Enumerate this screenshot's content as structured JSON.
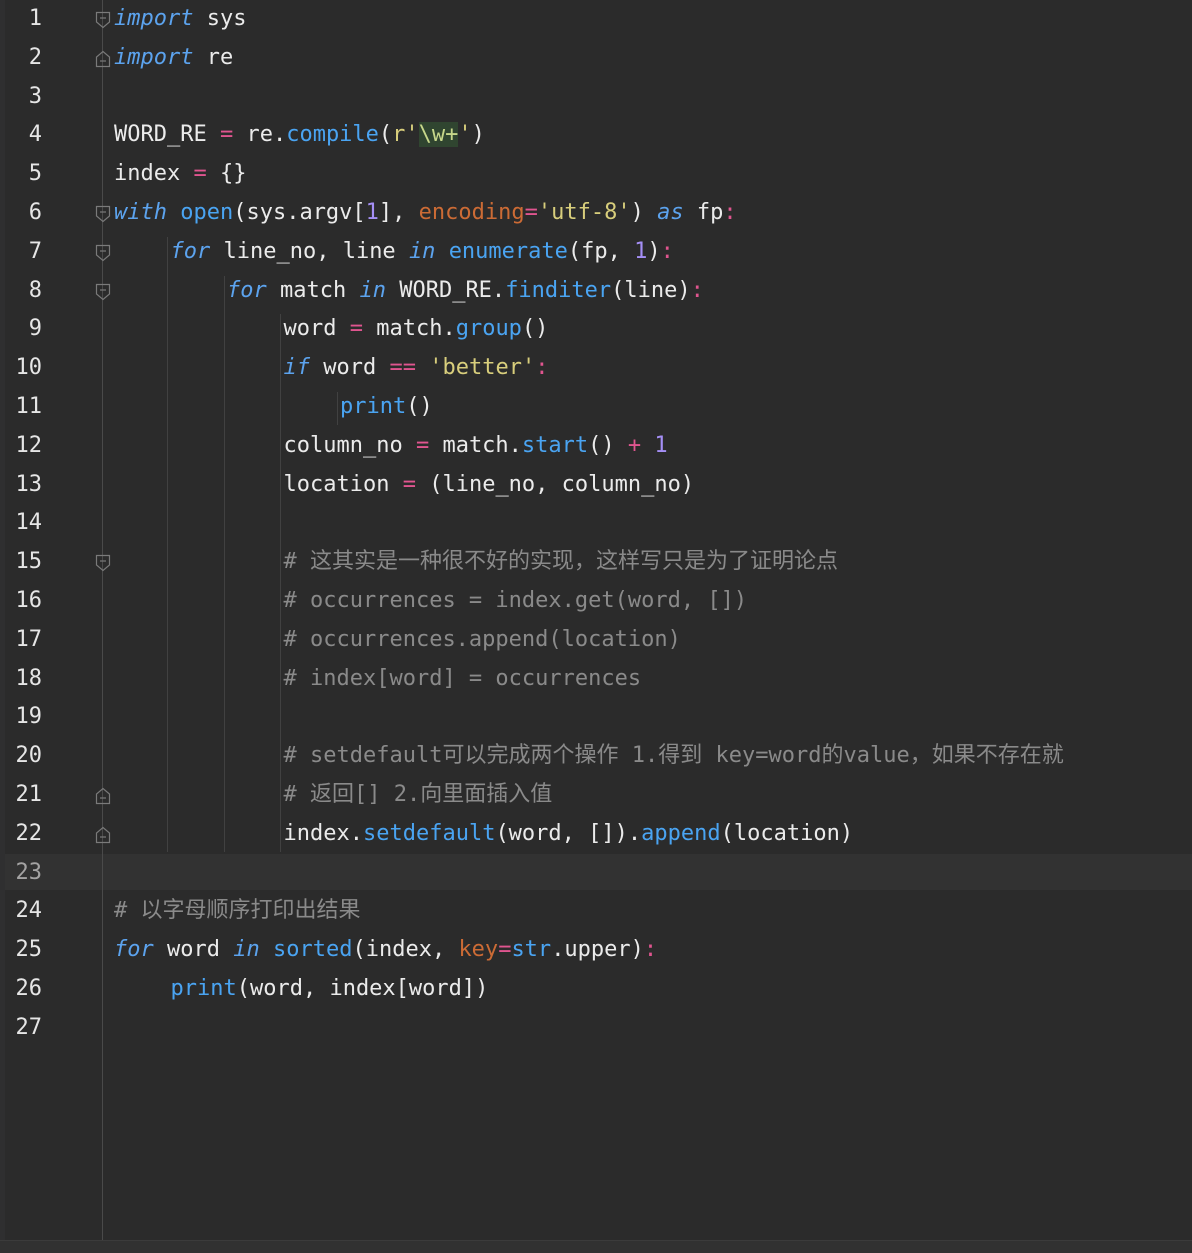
{
  "colors": {
    "background": "#2b2b2b",
    "keyword": "#5ca3ee",
    "function": "#4aa4f2",
    "number": "#a58ff6",
    "string": "#d8ce7c",
    "keyword_arg": "#cc6b35",
    "operator": "#e0558f",
    "comment": "#8a8a8a",
    "text": "#ebebeb"
  },
  "icons": {
    "fold_open": "fold-open-icon",
    "fold_close": "fold-end-icon"
  },
  "current_line": 23,
  "lines": [
    {
      "n": "1",
      "indent": 0,
      "fold": "open",
      "tokens": [
        [
          "kw",
          "import"
        ],
        [
          "t",
          " sys"
        ]
      ]
    },
    {
      "n": "2",
      "indent": 0,
      "fold": "end",
      "tokens": [
        [
          "kw",
          "import"
        ],
        [
          "t",
          " re"
        ]
      ]
    },
    {
      "n": "3",
      "indent": 0,
      "fold": "",
      "tokens": []
    },
    {
      "n": "4",
      "indent": 0,
      "fold": "",
      "tokens": [
        [
          "t",
          "WORD_RE "
        ],
        [
          "op",
          "="
        ],
        [
          "t",
          " re."
        ],
        [
          "fn",
          "compile"
        ],
        [
          "t",
          "("
        ],
        [
          "str",
          "r'"
        ],
        [
          "esc",
          "\\w+"
        ],
        [
          "str",
          "'"
        ],
        [
          "t",
          ")"
        ]
      ]
    },
    {
      "n": "5",
      "indent": 0,
      "fold": "",
      "tokens": [
        [
          "t",
          "index "
        ],
        [
          "op",
          "="
        ],
        [
          "t",
          " {}"
        ]
      ]
    },
    {
      "n": "6",
      "indent": 0,
      "fold": "open",
      "tokens": [
        [
          "kw",
          "with"
        ],
        [
          "t",
          " "
        ],
        [
          "fn",
          "open"
        ],
        [
          "t",
          "(sys.argv["
        ],
        [
          "num",
          "1"
        ],
        [
          "t",
          "], "
        ],
        [
          "kwarg",
          "encoding"
        ],
        [
          "op",
          "="
        ],
        [
          "str",
          "'utf-8'"
        ],
        [
          "t",
          ") "
        ],
        [
          "kw",
          "as"
        ],
        [
          "t",
          " fp"
        ],
        [
          "op",
          ":"
        ]
      ]
    },
    {
      "n": "7",
      "indent": 1,
      "fold": "open",
      "tokens": [
        [
          "kw",
          "for"
        ],
        [
          "t",
          " line_no, line "
        ],
        [
          "kw",
          "in"
        ],
        [
          "t",
          " "
        ],
        [
          "fn",
          "enumerate"
        ],
        [
          "t",
          "(fp, "
        ],
        [
          "num",
          "1"
        ],
        [
          "t",
          ")"
        ],
        [
          "op",
          ":"
        ]
      ]
    },
    {
      "n": "8",
      "indent": 2,
      "fold": "open",
      "tokens": [
        [
          "kw",
          "for"
        ],
        [
          "t",
          " match "
        ],
        [
          "kw",
          "in"
        ],
        [
          "t",
          " WORD_RE."
        ],
        [
          "fn",
          "finditer"
        ],
        [
          "t",
          "(line)"
        ],
        [
          "op",
          ":"
        ]
      ]
    },
    {
      "n": "9",
      "indent": 3,
      "fold": "",
      "tokens": [
        [
          "t",
          "word "
        ],
        [
          "op",
          "="
        ],
        [
          "t",
          " match."
        ],
        [
          "fn",
          "group"
        ],
        [
          "t",
          "()"
        ]
      ]
    },
    {
      "n": "10",
      "indent": 3,
      "fold": "",
      "tokens": [
        [
          "kw",
          "if"
        ],
        [
          "t",
          " word "
        ],
        [
          "op",
          "=="
        ],
        [
          "t",
          " "
        ],
        [
          "str",
          "'better'"
        ],
        [
          "op",
          ":"
        ]
      ]
    },
    {
      "n": "11",
      "indent": 4,
      "fold": "",
      "tokens": [
        [
          "fn",
          "print"
        ],
        [
          "t",
          "()"
        ]
      ]
    },
    {
      "n": "12",
      "indent": 3,
      "fold": "",
      "tokens": [
        [
          "t",
          "column_no "
        ],
        [
          "op",
          "="
        ],
        [
          "t",
          " match."
        ],
        [
          "fn",
          "start"
        ],
        [
          "t",
          "() "
        ],
        [
          "op",
          "+"
        ],
        [
          "t",
          " "
        ],
        [
          "num",
          "1"
        ]
      ]
    },
    {
      "n": "13",
      "indent": 3,
      "fold": "",
      "tokens": [
        [
          "t",
          "location "
        ],
        [
          "op",
          "="
        ],
        [
          "t",
          " (line_no, column_no)"
        ]
      ]
    },
    {
      "n": "14",
      "indent": 0,
      "fold": "",
      "tokens": []
    },
    {
      "n": "15",
      "indent": 3,
      "fold": "open",
      "tokens": [
        [
          "cmt",
          "# "
        ],
        [
          "cmtcn",
          "这其实是一种很不好的实现，这样写只是为了证明论点"
        ]
      ]
    },
    {
      "n": "16",
      "indent": 3,
      "fold": "",
      "tokens": [
        [
          "cmt",
          "# occurrences = index.get(word, [])"
        ]
      ]
    },
    {
      "n": "17",
      "indent": 3,
      "fold": "",
      "tokens": [
        [
          "cmt",
          "# occurrences.append(location)"
        ]
      ]
    },
    {
      "n": "18",
      "indent": 3,
      "fold": "",
      "tokens": [
        [
          "cmt",
          "# index[word] = occurrences"
        ]
      ]
    },
    {
      "n": "19",
      "indent": 0,
      "fold": "",
      "tokens": []
    },
    {
      "n": "20",
      "indent": 3,
      "fold": "",
      "tokens": [
        [
          "cmt",
          "# setdefault"
        ],
        [
          "cmtcn",
          "可以完成两个操作"
        ],
        [
          "cmt",
          " 1."
        ],
        [
          "cmtcn",
          "得到"
        ],
        [
          "cmt",
          " key=word"
        ],
        [
          "cmtcn",
          "的"
        ],
        [
          "cmt",
          "value"
        ],
        [
          "cmtcn",
          "，如果不存在就"
        ]
      ]
    },
    {
      "n": "21",
      "indent": 3,
      "fold": "end",
      "tokens": [
        [
          "cmt",
          "# "
        ],
        [
          "cmtcn",
          "返回"
        ],
        [
          "cmt",
          "[] 2."
        ],
        [
          "cmtcn",
          "向里面插入值"
        ]
      ]
    },
    {
      "n": "22",
      "indent": 3,
      "fold": "end",
      "tokens": [
        [
          "t",
          "index."
        ],
        [
          "fn",
          "setdefault"
        ],
        [
          "t",
          "(word, [])."
        ],
        [
          "fn",
          "append"
        ],
        [
          "t",
          "(location)"
        ]
      ]
    },
    {
      "n": "23",
      "indent": 0,
      "fold": "",
      "tokens": []
    },
    {
      "n": "24",
      "indent": 0,
      "fold": "",
      "tokens": [
        [
          "cmt",
          "# "
        ],
        [
          "cmtcn",
          "以字母顺序打印出结果"
        ]
      ]
    },
    {
      "n": "25",
      "indent": 0,
      "fold": "",
      "tokens": [
        [
          "kw",
          "for"
        ],
        [
          "t",
          " word "
        ],
        [
          "kw",
          "in"
        ],
        [
          "t",
          " "
        ],
        [
          "fn",
          "sorted"
        ],
        [
          "t",
          "(index, "
        ],
        [
          "kwarg",
          "key"
        ],
        [
          "op",
          "="
        ],
        [
          "fn",
          "str"
        ],
        [
          "t",
          ".upper)"
        ],
        [
          "op",
          ":"
        ]
      ]
    },
    {
      "n": "26",
      "indent": 1,
      "fold": "",
      "tokens": [
        [
          "fn",
          "print"
        ],
        [
          "t",
          "(word, index[word])"
        ]
      ]
    },
    {
      "n": "27",
      "indent": 0,
      "fold": "",
      "tokens": []
    }
  ]
}
